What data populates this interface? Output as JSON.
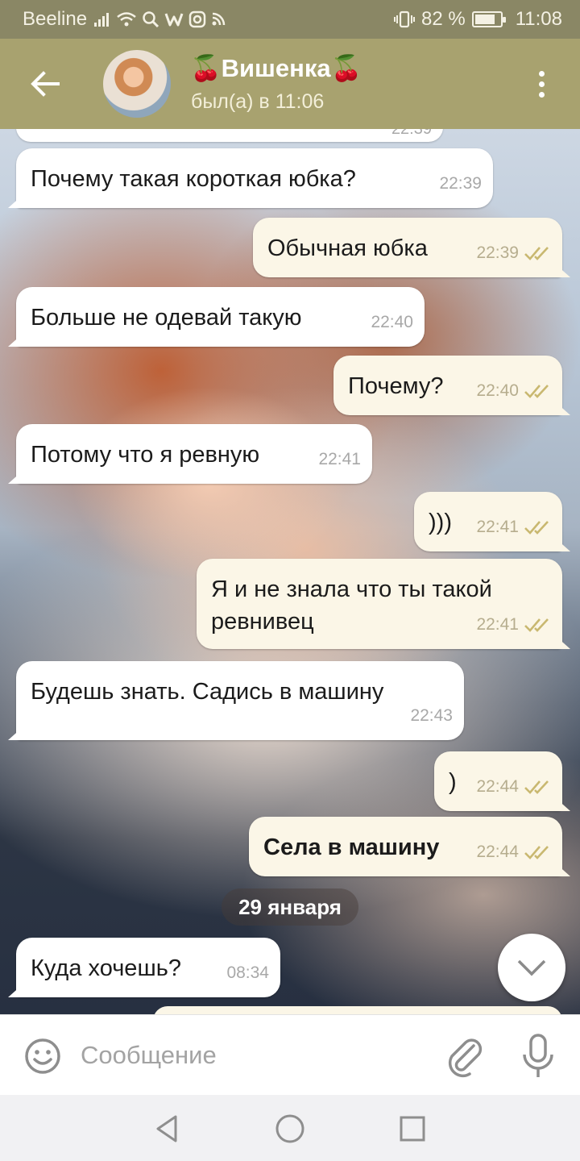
{
  "status_bar": {
    "carrier": "Beeline",
    "battery": "82 %",
    "battery_level": 0.82,
    "time": "11:08",
    "icons": [
      "signal-icon",
      "wifi-icon",
      "search-icon",
      "w-app-icon",
      "instagram-icon",
      "rss-icon",
      "vibrate-icon",
      "battery-icon"
    ]
  },
  "header": {
    "title": "🍒Вишенка🍒",
    "subtitle": "был(а) в 11:06"
  },
  "chat": {
    "partial_time": "22:39",
    "messages": [
      {
        "direction": "in",
        "text": "Почему такая короткая юбка?",
        "time": "22:39"
      },
      {
        "direction": "out",
        "text": "Обычная юбка",
        "time": "22:39",
        "read": true
      },
      {
        "direction": "in",
        "text": "Больше не одевай такую",
        "time": "22:40"
      },
      {
        "direction": "out",
        "text": "Почему?",
        "time": "22:40",
        "read": true
      },
      {
        "direction": "in",
        "text": "Потому что я ревную",
        "time": "22:41"
      },
      {
        "direction": "out",
        "text": ")))",
        "time": "22:41",
        "read": true
      },
      {
        "direction": "out",
        "text": "Я и не знала что ты такой ревнивец",
        "time": "22:41",
        "read": true
      },
      {
        "direction": "in",
        "text": "Будешь знать. Садись в машину",
        "time": "22:43"
      },
      {
        "direction": "out",
        "text": ")",
        "time": "22:44",
        "read": true
      },
      {
        "direction": "out",
        "text": "Села в машину",
        "time": "22:44",
        "read": true
      },
      {
        "direction": "in",
        "text": "Куда хочешь?",
        "time": "08:34"
      }
    ],
    "date_separator": "29 января"
  },
  "input": {
    "placeholder": "Сообщение"
  },
  "colors": {
    "status_bar": "#8a8765",
    "header": "#a8a26f",
    "outgoing_bubble": "#fbf6e7",
    "incoming_bubble": "#ffffff",
    "read_check": "#c9b870"
  }
}
